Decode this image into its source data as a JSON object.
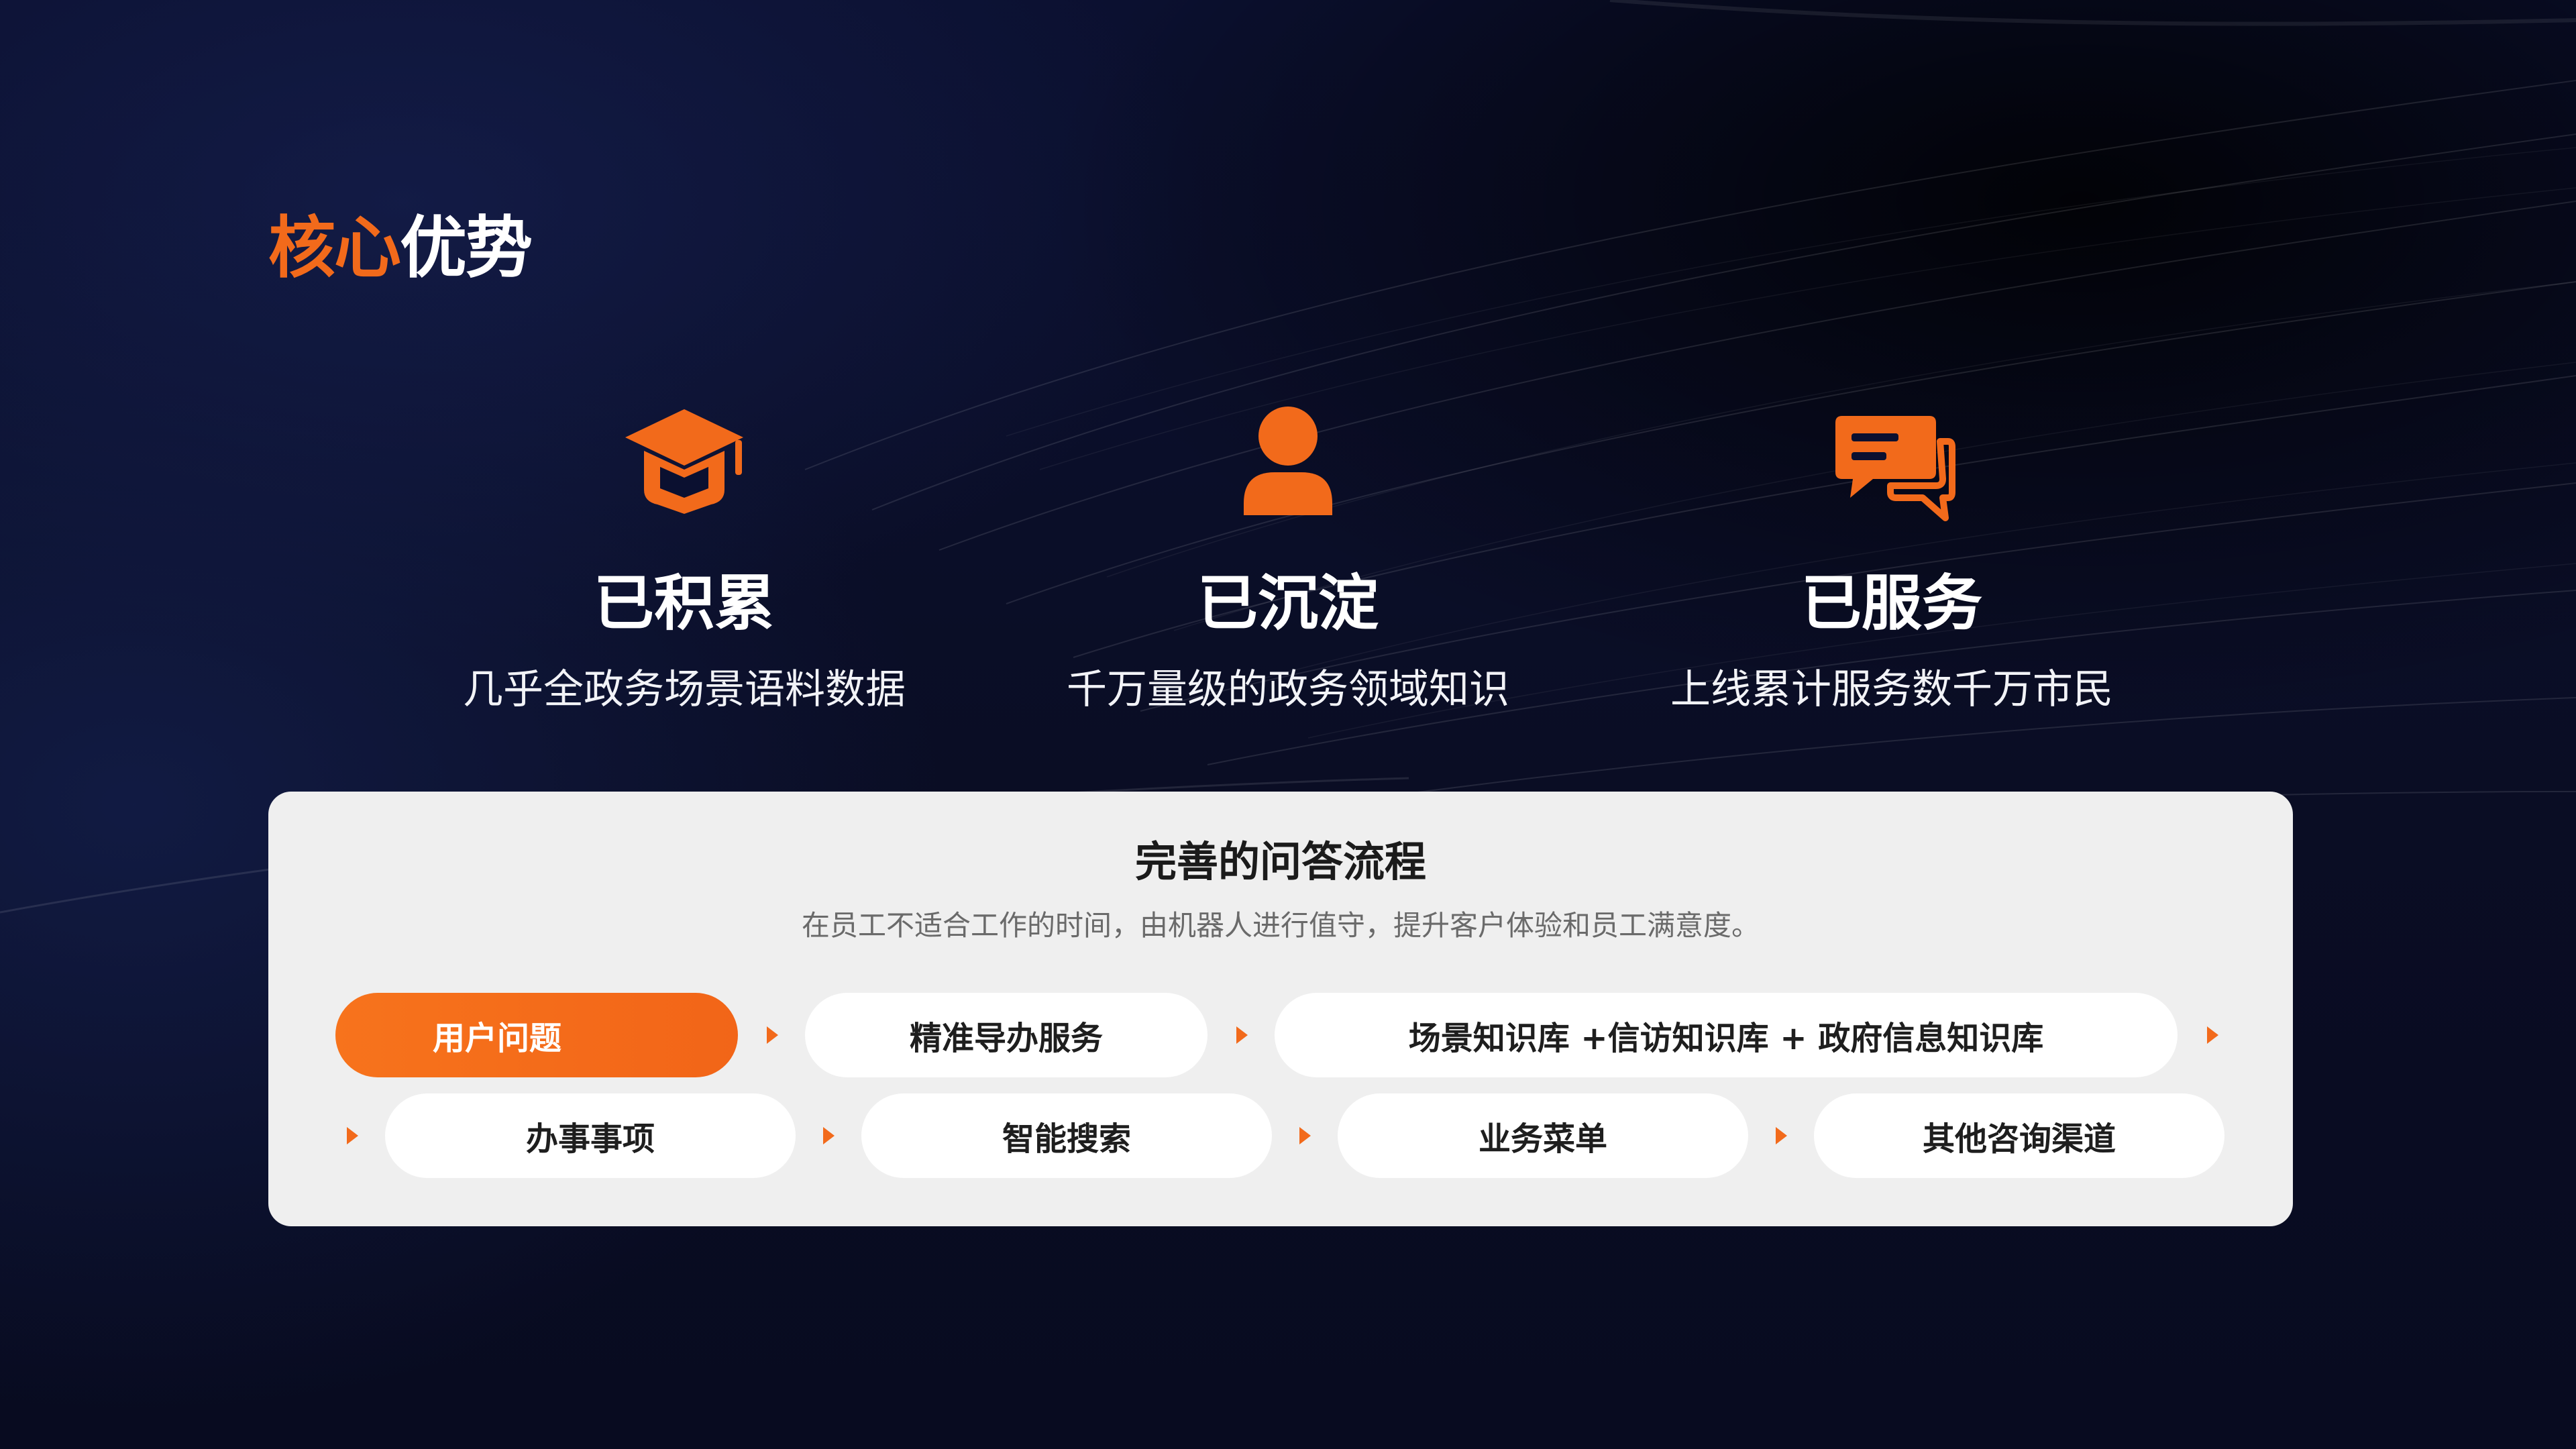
{
  "header": {
    "title_accent": "核心",
    "title_rest": "优势"
  },
  "features": [
    {
      "icon": "graduation-cap-icon",
      "title": "已积累",
      "desc": "几乎全政务场景语料数据"
    },
    {
      "icon": "user-icon",
      "title": "已沉淀",
      "desc": "千万量级的政务领域知识"
    },
    {
      "icon": "chat-bubbles-icon",
      "title": "已服务",
      "desc": "上线累计服务数千万市民"
    }
  ],
  "flow": {
    "title": "完善的问答流程",
    "subtitle": "在员工不适合工作的时间，由机器人进行值守，提升客户体验和员工满意度。",
    "steps": [
      "用户问题",
      "精准导办服务",
      "场景知识库 +信访知识库 + 政府信息知识库",
      "办事事项",
      "智能搜索",
      "业务菜单",
      "其他咨询渠道"
    ]
  },
  "colors": {
    "accent": "#f26a1b",
    "background": "#0a0d24",
    "panel": "#efefef"
  }
}
